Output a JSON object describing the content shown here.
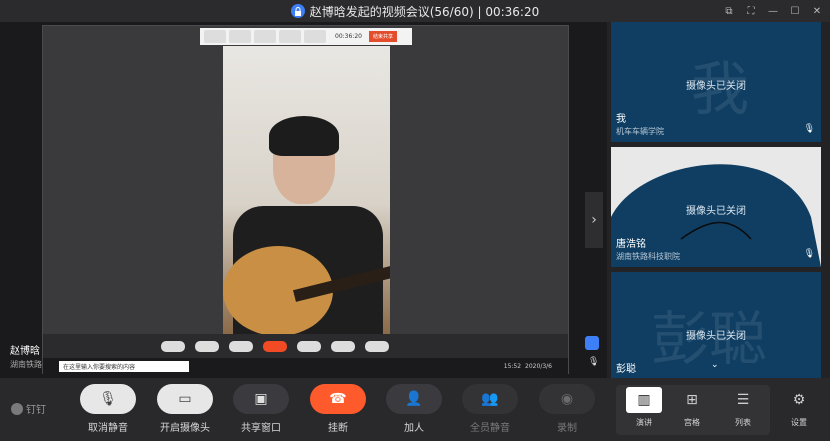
{
  "titlebar": {
    "title": "赵博晗发起的视频会议(56/60) | 00:36:20"
  },
  "inner_toolbar": {
    "timer": "00:36:20",
    "end_label": "结束共享"
  },
  "tray": {
    "search_placeholder": "在这里输入你要搜索的内容",
    "time": "15:52",
    "date": "2020/3/6"
  },
  "presenter": {
    "name": "赵博晗",
    "org": "湖南铁路"
  },
  "participants": [
    {
      "big_char": "我",
      "camera_status": "摄像头已关闭",
      "name": "我",
      "org": "机车车辆学院"
    },
    {
      "big_char": "",
      "camera_status": "摄像头已关闭",
      "name": "唐浩铭",
      "org": "湖南铁路科技职院"
    },
    {
      "big_char": "彭聪",
      "camera_status": "摄像头已关闭",
      "name": "彭聪",
      "org": ""
    }
  ],
  "app_logo": "钉钉",
  "controls": [
    {
      "label": "取消静音",
      "icon": "mic-off-icon"
    },
    {
      "label": "开启摄像头",
      "icon": "camera-off-icon"
    },
    {
      "label": "共享窗口",
      "icon": "share-window-icon"
    },
    {
      "label": "挂断",
      "icon": "hangup-icon"
    },
    {
      "label": "加人",
      "icon": "add-person-icon"
    },
    {
      "label": "全员静音",
      "icon": "mute-all-icon"
    },
    {
      "label": "录制",
      "icon": "record-icon"
    }
  ],
  "views": [
    {
      "label": "演讲",
      "icon": "speaker-view-icon"
    },
    {
      "label": "宫格",
      "icon": "grid-view-icon"
    },
    {
      "label": "列表",
      "icon": "list-view-icon"
    }
  ],
  "settings_label": "设置",
  "colors": {
    "hangup": "#ff5a2c",
    "tile": "#0f3e62",
    "accent": "#3d7ff6"
  }
}
